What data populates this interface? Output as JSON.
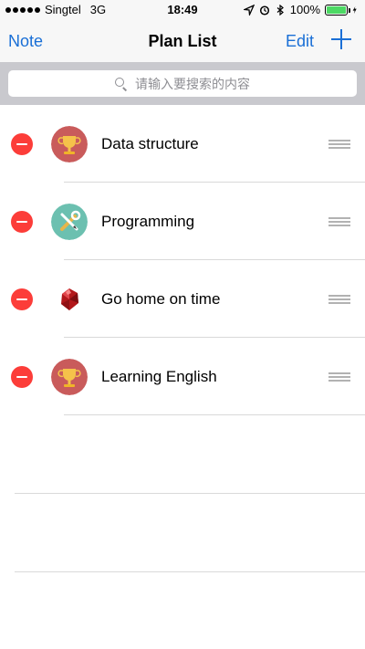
{
  "status_bar": {
    "carrier": "Singtel",
    "network": "3G",
    "time": "18:49",
    "battery": "100%",
    "signal_dots_filled": 5
  },
  "nav": {
    "left_label": "Note",
    "title": "Plan List",
    "edit_label": "Edit",
    "add_icon": "plus-icon"
  },
  "search": {
    "placeholder": "请输入要搜索的内容",
    "icon": "search-icon"
  },
  "plans": [
    {
      "title": "Data structure",
      "icon": "trophy-icon",
      "icon_bg": "#c95b5b"
    },
    {
      "title": "Programming",
      "icon": "tools-icon",
      "icon_bg": "#6cc0b0"
    },
    {
      "title": "Go home on time",
      "icon": "ruby-icon",
      "icon_bg": "#ffffff"
    },
    {
      "title": "Learning English",
      "icon": "trophy-icon",
      "icon_bg": "#c95b5b"
    }
  ],
  "colors": {
    "accent": "#1a6fd6",
    "delete": "#fc3d39",
    "battery": "#4cd964"
  }
}
